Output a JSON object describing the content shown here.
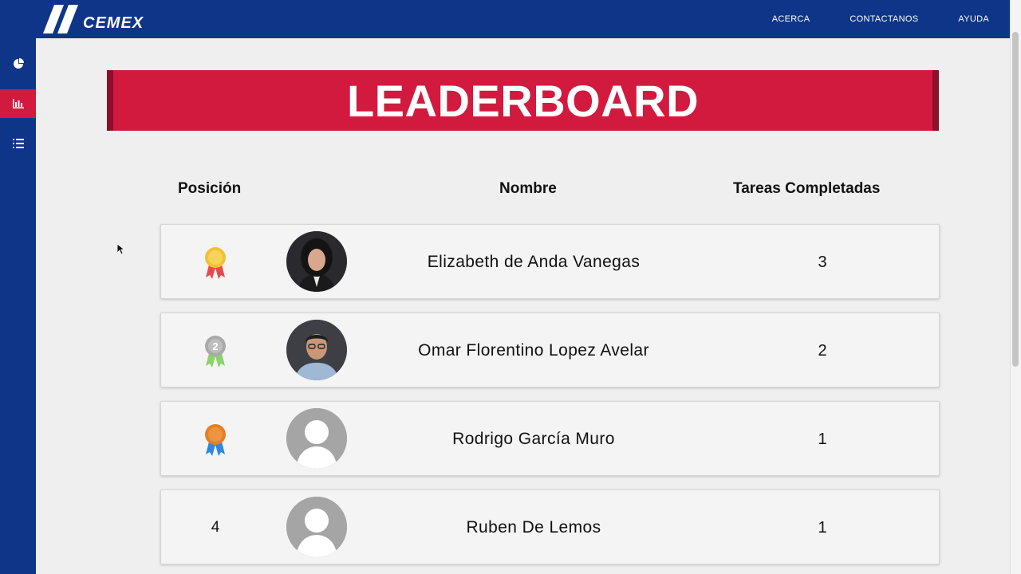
{
  "brand": {
    "name": "CEMEX"
  },
  "nav": {
    "items": [
      "ACERCA",
      "CONTACTANOS",
      "AYUDA"
    ]
  },
  "sidebar": {
    "items": [
      {
        "icon": "pie-chart-icon",
        "active": false
      },
      {
        "icon": "bar-chart-icon",
        "active": true
      },
      {
        "icon": "list-icon",
        "active": false
      }
    ]
  },
  "banner": {
    "title": "LEADERBOARD"
  },
  "table": {
    "headers": {
      "position": "Posición",
      "name": "Nombre",
      "tasks": "Tareas Completadas"
    },
    "rows": [
      {
        "position": "1",
        "medal": "gold-medal-icon",
        "name": "Elizabeth de Anda Vanegas",
        "tasks": "3",
        "avatar": "photo-woman"
      },
      {
        "position": "2",
        "medal": "silver-medal-icon",
        "name": "Omar Florentino Lopez Avelar",
        "tasks": "2",
        "avatar": "photo-man"
      },
      {
        "position": "3",
        "medal": "bronze-medal-icon",
        "name": "Rodrigo García Muro",
        "tasks": "1",
        "avatar": "placeholder"
      },
      {
        "position": "4",
        "medal": null,
        "name": "Ruben De Lemos",
        "tasks": "1",
        "avatar": "placeholder"
      }
    ]
  },
  "colors": {
    "navy": "#0f3588",
    "red": "#d21a3f",
    "darkred": "#8e0f29",
    "gold": "#f2c233",
    "silver": "#a9a9a9",
    "bronze": "#e67e22"
  }
}
